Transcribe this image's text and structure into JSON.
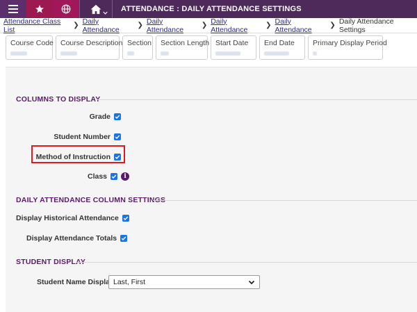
{
  "topbar": {
    "title": "ATTENDANCE : DAILY ATTENDANCE SETTINGS",
    "icons": [
      "menu-icon",
      "star-icon",
      "globe-icon",
      "home-icon",
      "chevron-down-icon"
    ]
  },
  "breadcrumb": {
    "links": [
      "Attendance Class List",
      "Daily Attendance",
      "Daily Attendance",
      "Daily Attendance",
      "Daily Attendance"
    ],
    "current": "Daily Attendance Settings"
  },
  "cards": [
    {
      "label": "Course Code"
    },
    {
      "label": "Course Description"
    },
    {
      "label": "Section"
    },
    {
      "label": "Section Length"
    },
    {
      "label": "Start Date"
    },
    {
      "label": "End Date"
    },
    {
      "label": "Primary Display Period"
    }
  ],
  "columns_to_display": {
    "title": "COLUMNS TO DISPLAY",
    "grade": {
      "label": "Grade",
      "checked": true
    },
    "student_number": {
      "label": "Student Number",
      "checked": true
    },
    "method_of_instruction": {
      "label": "Method of Instruction",
      "checked": true
    },
    "class": {
      "label": "Class",
      "checked": true,
      "info": "i"
    }
  },
  "daily_attendance_column_settings": {
    "title": "DAILY ATTENDANCE COLUMN SETTINGS",
    "display_historical": {
      "label": "Display Historical Attendance",
      "checked": true
    },
    "display_totals": {
      "label": "Display Attendance Totals",
      "checked": true
    }
  },
  "student_display": {
    "title": "STUDENT DISPLAY",
    "name_display": {
      "label": "Student Name Display",
      "value": "Last, First"
    }
  },
  "colors": {
    "accent": "#5a1a6a",
    "topbar": "#4e2a5a",
    "checkbox": "#1a73e8",
    "highlight": "#e01b1b"
  }
}
